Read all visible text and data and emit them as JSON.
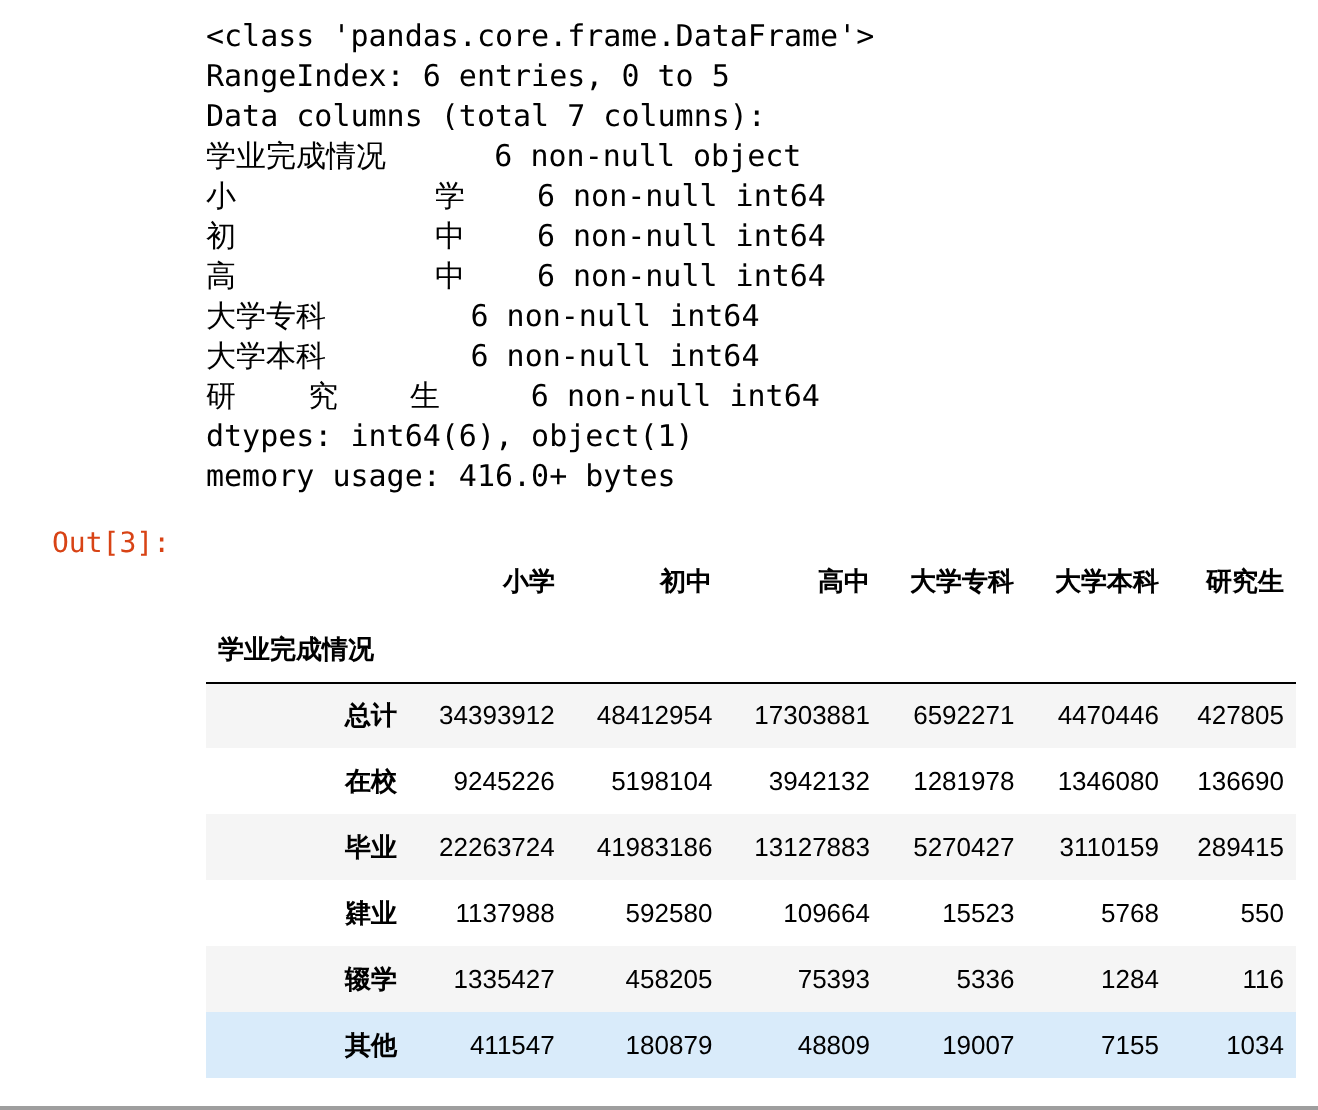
{
  "info_lines": [
    "<class 'pandas.core.frame.DataFrame'>",
    "RangeIndex: 6 entries, 0 to 5",
    "Data columns (total 7 columns):",
    "学业完成情况      6 non-null object",
    "小           学    6 non-null int64",
    "初           中    6 non-null int64",
    "高           中    6 non-null int64",
    "大学专科        6 non-null int64",
    "大学本科        6 non-null int64",
    "研    究    生     6 non-null int64",
    "dtypes: int64(6), object(1)",
    "memory usage: 416.0+ bytes"
  ],
  "out_prompt": "Out[3]:",
  "table": {
    "columns": [
      "小学",
      "初中",
      "高中",
      "大学专科",
      "大学本科",
      "研究生"
    ],
    "index_name": "学业完成情况",
    "rows": [
      {
        "label": "总计",
        "values": [
          "34393912",
          "48412954",
          "17303881",
          "6592271",
          "4470446",
          "427805"
        ],
        "hovered": false
      },
      {
        "label": "在校",
        "values": [
          "9245226",
          "5198104",
          "3942132",
          "1281978",
          "1346080",
          "136690"
        ],
        "hovered": false
      },
      {
        "label": "毕业",
        "values": [
          "22263724",
          "41983186",
          "13127883",
          "5270427",
          "3110159",
          "289415"
        ],
        "hovered": false
      },
      {
        "label": "肄业",
        "values": [
          "1137988",
          "592580",
          "109664",
          "15523",
          "5768",
          "550"
        ],
        "hovered": false
      },
      {
        "label": "辍学",
        "values": [
          "1335427",
          "458205",
          "75393",
          "5336",
          "1284",
          "116"
        ],
        "hovered": false
      },
      {
        "label": "其他",
        "values": [
          "411547",
          "180879",
          "48809",
          "19007",
          "7155",
          "1034"
        ],
        "hovered": true
      }
    ]
  }
}
